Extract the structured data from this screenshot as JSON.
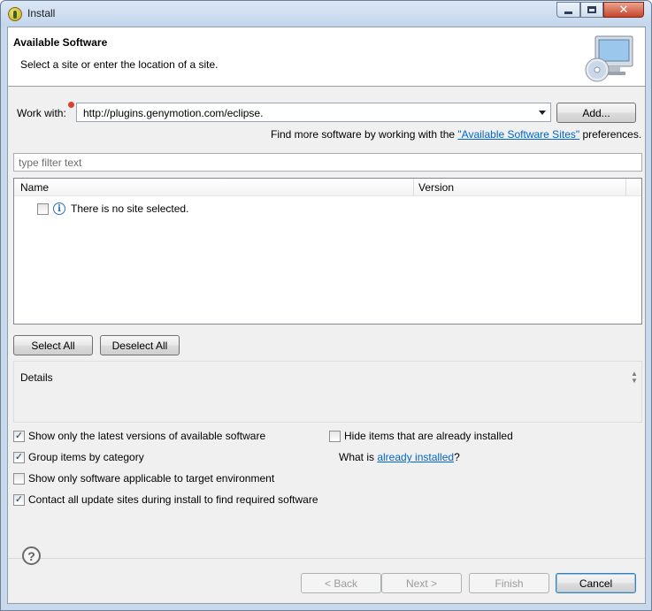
{
  "window": {
    "title": "Install"
  },
  "header": {
    "title": "Available Software",
    "subtitle": "Select a site or enter the location of a site."
  },
  "work_with": {
    "label": "Work with:",
    "value": "http://plugins.genymotion.com/eclipse.",
    "add_label": "Add..."
  },
  "find_more": {
    "prefix": "Find more software by working with the ",
    "link": "\"Available Software Sites\"",
    "suffix": " preferences."
  },
  "filter": {
    "placeholder": "type filter text"
  },
  "table": {
    "columns": [
      "Name",
      "Version"
    ],
    "rows": [
      {
        "label": "There is no site selected.",
        "checked": false,
        "icon": "info-icon"
      }
    ]
  },
  "buttons": {
    "select_all": "Select All",
    "deselect_all": "Deselect All",
    "back": "< Back",
    "next": "Next >",
    "finish": "Finish",
    "cancel": "Cancel"
  },
  "details": {
    "label": "Details"
  },
  "options": {
    "show_latest": {
      "label": "Show only the latest versions of available software",
      "checked": true
    },
    "group_by_category": {
      "label": "Group items by category",
      "checked": true
    },
    "show_applicable": {
      "label": "Show only software applicable to target environment",
      "checked": false
    },
    "contact_all": {
      "label": "Contact all update sites during install to find required software",
      "checked": true
    },
    "hide_installed": {
      "label": "Hide items that are already installed",
      "checked": false
    }
  },
  "what_is": {
    "prefix": "What is ",
    "link": "already installed",
    "suffix": "?"
  }
}
